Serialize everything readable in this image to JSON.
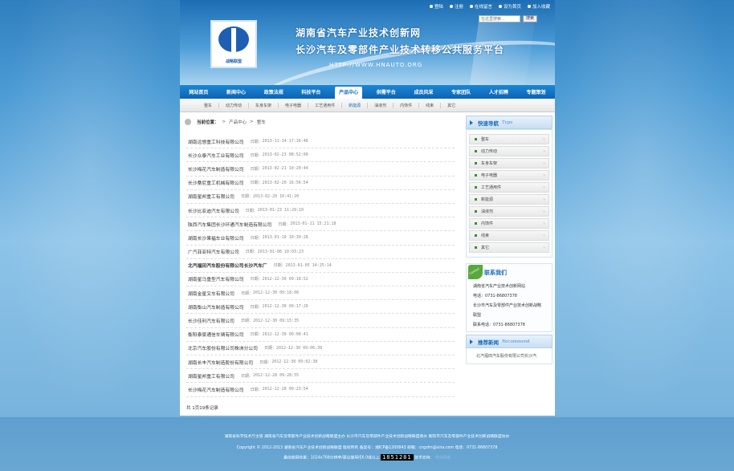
{
  "header": {
    "logo_name": "战略联盟",
    "title": "湖南省汽车产业技术创新网",
    "subtitle": "长沙汽车及零部件产业技术转移公共服务平台",
    "url": "HTTP://WWW.HNAUTO.ORG",
    "top_links": [
      "登陆",
      "注册",
      "在线留言",
      "设为首页",
      "加入收藏"
    ],
    "search": {
      "placeholder": "在这里搜索...",
      "button": "搜索"
    }
  },
  "nav": {
    "items": [
      "网站首页",
      "新闻中心",
      "政策法规",
      "科技平台",
      "产品中心",
      "供需平台",
      "成员风采",
      "专家团队",
      "人才招聘",
      "专题策划"
    ],
    "active_index": 4
  },
  "subnav": {
    "items": [
      "整车",
      "动力传动",
      "车身车架",
      "电子电器",
      "工艺通用件",
      "新能源",
      "油液剂",
      "内饰件",
      "线束",
      "其它"
    ],
    "active_index": 5
  },
  "breadcrumb": {
    "label": "当前位置：",
    "path": [
      "产品中心",
      "整车"
    ]
  },
  "list": {
    "date_prefix": "日期：",
    "rows": [
      {
        "title": "湖南远想重工科技有限公司",
        "date": "2013-11-14 17:16:48",
        "bold": false
      },
      {
        "title": "长沙众泰汽车工业有限公司",
        "date": "2013-02-23 08:52:00",
        "bold": false
      },
      {
        "title": "长沙梅花汽车制造有限公司",
        "date": "2013-02-21 10:20:44",
        "bold": false
      },
      {
        "title": "长沙桑尼重工机械有限公司",
        "date": "2013-02-20 16:56:54",
        "bold": false
      },
      {
        "title": "湖南星邦重工有限公司",
        "date": "2013-02-20 16:41:20",
        "bold": false
      },
      {
        "title": "长沙比亚迪汽车有限公司",
        "date": "2013-01-23 11:29:10",
        "bold": false
      },
      {
        "title": "陕西汽车集团长沙环通汽车制造有限公司",
        "date": "2013-01-11 15:21:18",
        "bold": false
      },
      {
        "title": "湖南长沙果福车业有限公司",
        "date": "2013-01-10 10:39:28",
        "bold": false
      },
      {
        "title": "广汽菲亚特汽车有限公司",
        "date": "2013-01-08 10:03:23",
        "bold": false
      },
      {
        "title": "北汽福田汽车股份有限公司长沙汽车厂",
        "date": "2013-01-05 14:25:14",
        "bold": true
      },
      {
        "title": "湖南星马重型汽车有限公司",
        "date": "2012-12-30 09:18:52",
        "bold": false
      },
      {
        "title": "湖南金星叉车有限公司",
        "date": "2012-12-30 09:18:06",
        "bold": false
      },
      {
        "title": "湖南衡山汽车制造有限公司",
        "date": "2012-12-30 09:17:26",
        "bold": false
      },
      {
        "title": "长沙佳利汽车有限公司",
        "date": "2012-12-30 09:15:35",
        "bold": false
      },
      {
        "title": "衡阳泰豪通信车辆有限公司",
        "date": "2012-12-30 09:08:41",
        "bold": false
      },
      {
        "title": "北京汽车股份有限公司株洲分公司",
        "date": "2012-12-30 09:06:39",
        "bold": false
      },
      {
        "title": "湖南长丰汽车制造股份有限公司",
        "date": "2012-12-30 09:02:38",
        "bold": false
      },
      {
        "title": "湖南星邦重工有限公司",
        "date": "2012-12-28 09:28:55",
        "bold": false
      },
      {
        "title": "长沙梅花汽车制造有限公司",
        "date": "2012-12-28 09:23:54",
        "bold": false
      }
    ],
    "total": "共 1页19条记录"
  },
  "sidebar": {
    "quick_nav": {
      "title": "快速导航",
      "title_en": "Type",
      "items": [
        "整车",
        "动力传动",
        "车身车架",
        "电子电器",
        "工艺通用件",
        "新能源",
        "油液剂",
        "内饰件",
        "线束",
        "其它"
      ]
    },
    "contact": {
      "title": "联系我们",
      "lines": [
        "湖南省汽车产业技术创新网站",
        "电话：0731-86807378",
        "长沙市汽车及零部件产业技术创新战略",
        "联盟",
        "联系电话：0731-86807378"
      ]
    },
    "recommend": {
      "title": "推荐新闻",
      "title_en": "Recommend",
      "item": "北汽福田汽车股份有限公司长沙汽"
    }
  },
  "footer": {
    "line1": "湖南省科学技术厅主管  湖南省汽车及零部件产业技术创新战略联盟主办  长沙市汽车及零部件产业技术创新战略联盟承办  衡阳市汽车及零部件产业技术创新战略联盟协办",
    "line2": "Copyright © 2012-2013 湖南省汽车产业技术创新战略联盟 版权所有 备案号：湘ICP备1200843 邮箱：cngzlm@sina.com 电话：0731-86807378",
    "line3_prefix": "最佳使用效果：1024x768分辨率/建议使用IE6.0或以上",
    "counter": "1851281",
    "line3_suffix": "技术支持：",
    "support": "华光网络"
  }
}
